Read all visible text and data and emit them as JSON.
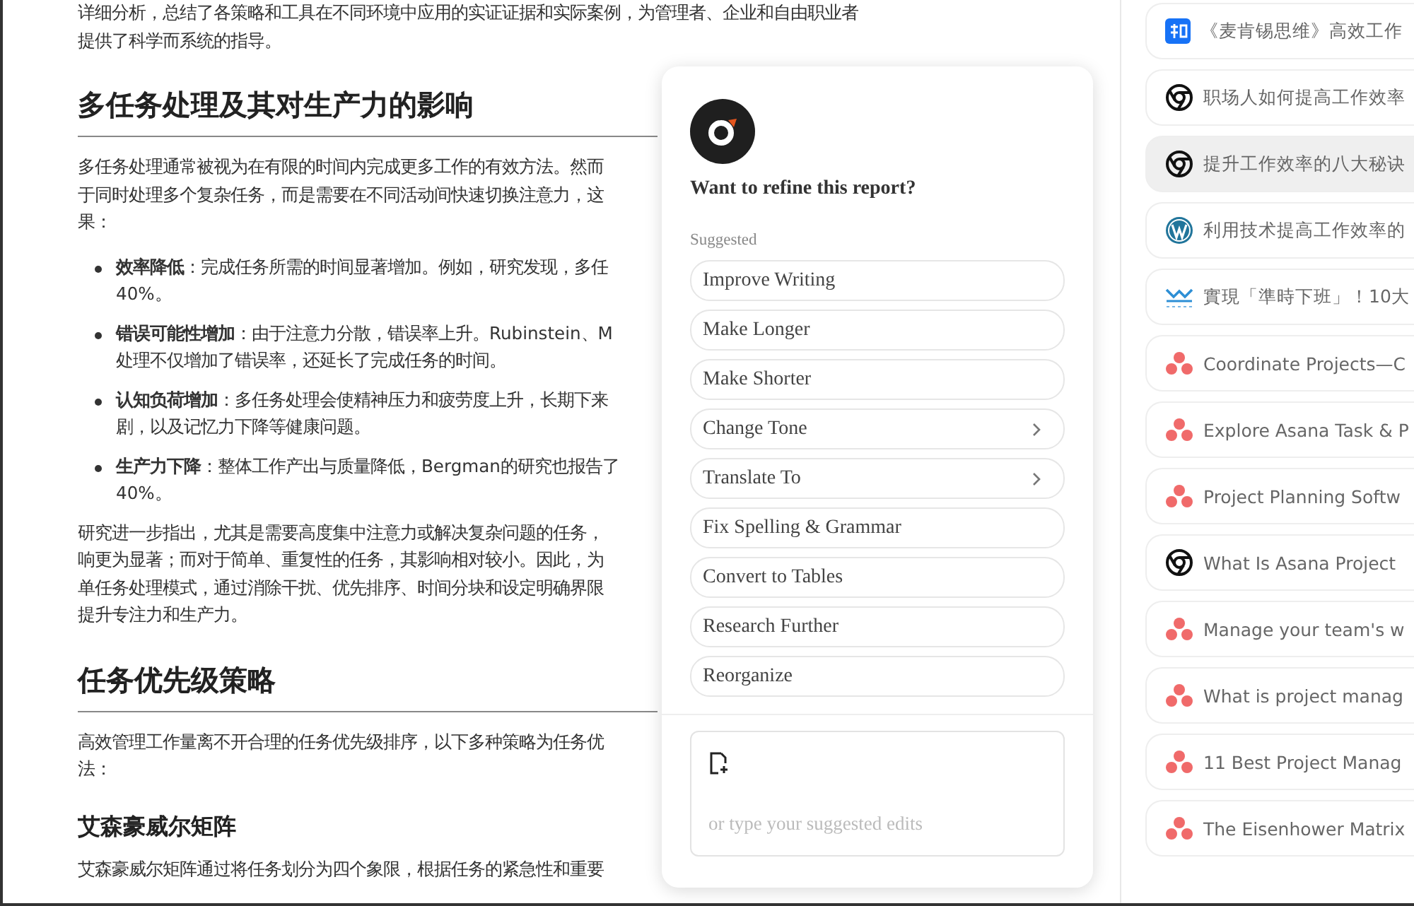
{
  "article": {
    "blocks": [
      {
        "kind": "p",
        "lines": [
          "详细分析，总结了各策略和工具在不同环境中应用的实证证据和实际案例，为管理者、企业和自由职业者",
          "提供了科学而系统的指导。"
        ]
      },
      {
        "kind": "h2",
        "text": "多任务处理及其对生产力的影响"
      },
      {
        "kind": "p",
        "lines": [
          "多任务处理通常被视为在有限的时间内完成更多工作的有效方法。然而",
          "于同时处理多个复杂任务，而是需要在不同活动间快速切换注意力，这",
          "果："
        ]
      },
      {
        "kind": "li",
        "lines": [
          "**效率降低**：完成任务所需的时间显著增加。例如，研究发现，多任",
          "40%。"
        ]
      },
      {
        "kind": "li",
        "lines": [
          "**错误可能性增加**：由于注意力分散，错误率上升。Rubinstein、M",
          "处理不仅增加了错误率，还延长了完成任务的时间。"
        ]
      },
      {
        "kind": "li",
        "lines": [
          "**认知负荷增加**：多任务处理会使精神压力和疲劳度上升，长期下来",
          "剧，以及记忆力下降等健康问题。"
        ]
      },
      {
        "kind": "li",
        "lines": [
          "**生产力下降**：整体工作产出与质量降低，Bergman的研究也报告了",
          "40%。"
        ]
      },
      {
        "kind": "p",
        "lines": [
          "研究进一步指出，尤其是需要高度集中注意力或解决复杂问题的任务，",
          "响更为显著；而对于简单、重复性的任务，其影响相对较小。因此，为",
          "单任务处理模式，通过消除干扰、优先排序、时间分块和设定明确界限",
          "提升专注力和生产力。"
        ]
      },
      {
        "kind": "h2",
        "text": "任务优先级策略"
      },
      {
        "kind": "p",
        "lines": [
          "高效管理工作量离不开合理的任务优先级排序，以下多种策略为任务优",
          "法："
        ]
      },
      {
        "kind": "h3",
        "text": "艾森豪威尔矩阵"
      },
      {
        "kind": "p",
        "lines": [
          "艾森豪威尔矩阵通过将任务划分为四个象限，根据任务的紧急性和重要"
        ]
      }
    ]
  },
  "refine_panel": {
    "title": "Want to refine this report?",
    "section_label": "Suggested",
    "options": [
      {
        "label": "Improve Writing",
        "has_submenu": false
      },
      {
        "label": "Make Longer",
        "has_submenu": false
      },
      {
        "label": "Make Shorter",
        "has_submenu": false
      },
      {
        "label": "Change Tone",
        "has_submenu": true
      },
      {
        "label": "Translate To",
        "has_submenu": true
      },
      {
        "label": "Fix Spelling & Grammar",
        "has_submenu": false
      },
      {
        "label": "Convert to Tables",
        "has_submenu": false
      },
      {
        "label": "Research Further",
        "has_submenu": false
      },
      {
        "label": "Reorganize",
        "has_submenu": false
      }
    ],
    "input": {
      "placeholder": "or type your suggested edits"
    }
  },
  "sources": [
    {
      "kind": "zhihu",
      "title": "《麦肯锡思维》高效工作",
      "selected": false
    },
    {
      "kind": "chrome",
      "title": "职场人如何提高工作效率",
      "selected": false
    },
    {
      "kind": "chrome",
      "title": "提升工作效率的八大秘诀",
      "selected": true
    },
    {
      "kind": "wordpress",
      "title": "利用技术提高工作效率的",
      "selected": false
    },
    {
      "kind": "wave",
      "title": "實現「準時下班」！10大",
      "selected": false
    },
    {
      "kind": "asana",
      "title": "Coordinate Projects—C",
      "selected": false
    },
    {
      "kind": "asana",
      "title": "Explore Asana Task & P",
      "selected": false
    },
    {
      "kind": "asana",
      "title": "Project Planning Softw",
      "selected": false
    },
    {
      "kind": "chrome",
      "title": "What Is Asana Project",
      "selected": false
    },
    {
      "kind": "asana",
      "title": "Manage your team's w",
      "selected": false
    },
    {
      "kind": "asana",
      "title": "What is project manag",
      "selected": false
    },
    {
      "kind": "asana",
      "title": "11 Best Project Manag",
      "selected": false
    },
    {
      "kind": "asana",
      "title": "The Eisenhower Matrix",
      "selected": false
    }
  ]
}
